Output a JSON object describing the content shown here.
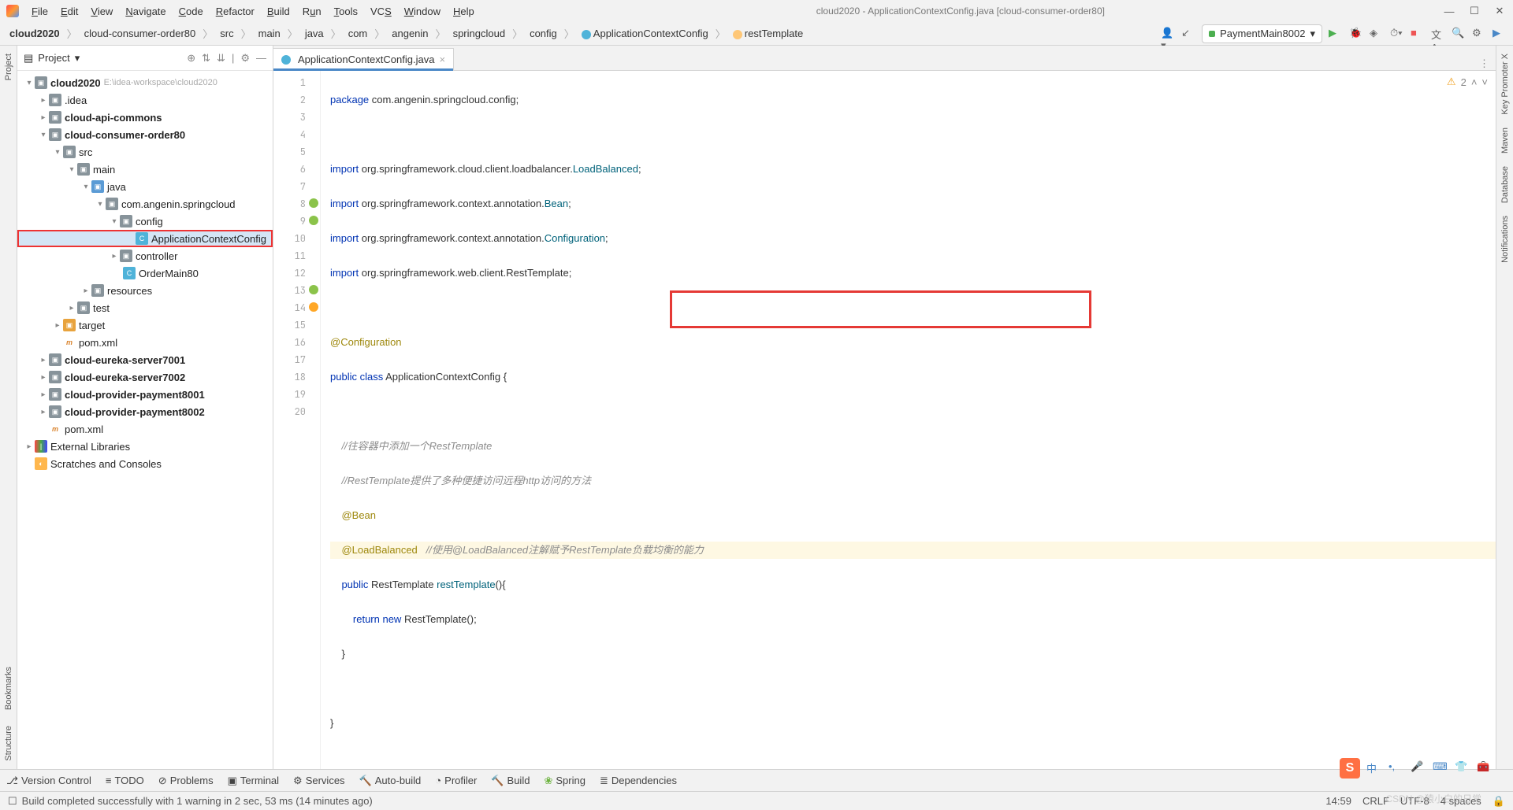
{
  "window": {
    "title": "cloud2020 - ApplicationContextConfig.java [cloud-consumer-order80]"
  },
  "menu": [
    "File",
    "Edit",
    "View",
    "Navigate",
    "Code",
    "Refactor",
    "Build",
    "Run",
    "Tools",
    "VCS",
    "Window",
    "Help"
  ],
  "breadcrumb": [
    "cloud2020",
    "cloud-consumer-order80",
    "src",
    "main",
    "java",
    "com",
    "angenin",
    "springcloud",
    "config",
    "ApplicationContextConfig",
    "restTemplate"
  ],
  "run_config": "PaymentMain8002",
  "project_panel": {
    "title": "Project",
    "root": {
      "name": "cloud2020",
      "hint": "E:\\idea-workspace\\cloud2020"
    },
    "children": [
      {
        "name": ".idea"
      },
      {
        "name": "cloud-api-commons"
      },
      {
        "name": "cloud-consumer-order80"
      },
      {
        "name": "src"
      },
      {
        "name": "main"
      },
      {
        "name": "java"
      },
      {
        "name": "com.angenin.springcloud"
      },
      {
        "name": "config"
      },
      {
        "name": "ApplicationContextConfig"
      },
      {
        "name": "controller"
      },
      {
        "name": "OrderMain80"
      },
      {
        "name": "resources"
      },
      {
        "name": "test"
      },
      {
        "name": "target"
      },
      {
        "name": "pom.xml"
      },
      {
        "name": "cloud-eureka-server7001"
      },
      {
        "name": "cloud-eureka-server7002"
      },
      {
        "name": "cloud-provider-payment8001"
      },
      {
        "name": "cloud-provider-payment8002"
      },
      {
        "name": "pom.xml"
      },
      {
        "name": "External Libraries"
      },
      {
        "name": "Scratches and Consoles"
      }
    ]
  },
  "tab": {
    "name": "ApplicationContextConfig.java"
  },
  "inspection": {
    "warnings": "2"
  },
  "code": {
    "l1_kw": "package",
    "l1_rest": " com.angenin.springcloud.config;",
    "l3_kw": "import",
    "l3_rest": " org.springframework.cloud.client.loadbalancer.",
    "l3_cls": "LoadBalanced",
    "l3_end": ";",
    "l4_kw": "import",
    "l4_rest": " org.springframework.context.annotation.",
    "l4_cls": "Bean",
    "l4_end": ";",
    "l5_kw": "import",
    "l5_rest": " org.springframework.context.annotation.",
    "l5_cls": "Configuration",
    "l5_end": ";",
    "l6_kw": "import",
    "l6_rest": " org.springframework.web.client.RestTemplate;",
    "l8": "@Configuration",
    "l9_kw1": "public ",
    "l9_kw2": "class ",
    "l9_cls": "ApplicationContextConfig ",
    "l9_br": "{",
    "l11": "    //往容器中添加一个RestTemplate",
    "l12": "    //RestTemplate提供了多种便捷访问远程http访问的方法",
    "l13": "    @Bean",
    "l14_ann": "    @LoadBalanced",
    "l14_cmt": "   //使用@LoadBalanced注解赋予RestTemplate负载均衡的能力",
    "l15_kw": "    public ",
    "l15_cls": "RestTemplate ",
    "l15_fn": "restTemplate",
    "l15_rest": "(){",
    "l16_kw": "        return new ",
    "l16_cls": "RestTemplate",
    "l16_rest": "();",
    "l17": "    }",
    "l19": "}"
  },
  "bottom_tabs": [
    "Version Control",
    "TODO",
    "Problems",
    "Terminal",
    "Services",
    "Auto-build",
    "Profiler",
    "Build",
    "Spring",
    "Dependencies"
  ],
  "status": {
    "left": "Build completed successfully with 1 warning in 2 sec, 53 ms (14 minutes ago)",
    "time": "14:59",
    "eol": "CRLF",
    "enc": "UTF-8",
    "indent": "4 spaces"
  },
  "left_tools": [
    "Project",
    "Bookmarks",
    "Structure"
  ],
  "right_tools": [
    "Key Promoter X",
    "Maven",
    "Database",
    "Notifications"
  ],
  "watermark": "CSDN @猿小白的日常"
}
